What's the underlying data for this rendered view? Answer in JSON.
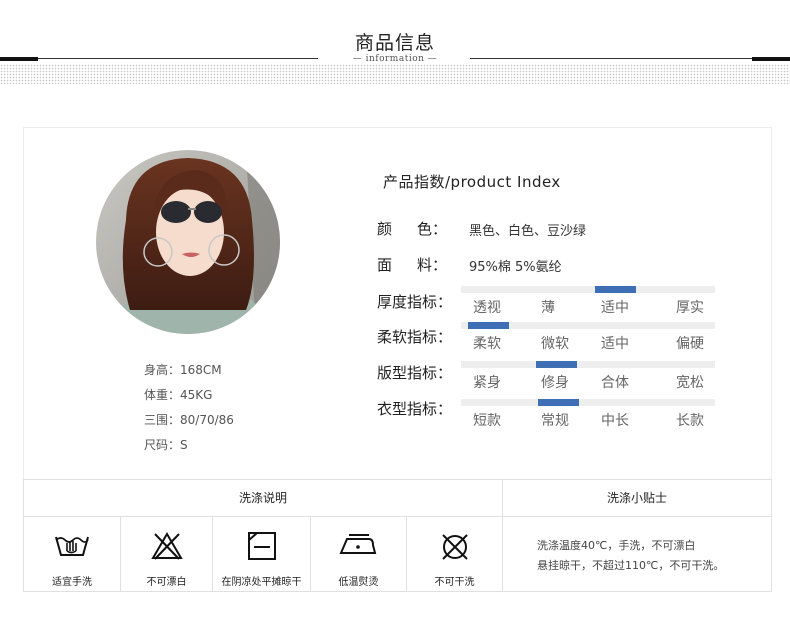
{
  "header": {
    "title": "商品信息",
    "subtitle": "— information —"
  },
  "model": {
    "height": "身高：168CM",
    "weight": "体重：45KG",
    "measurements": "三围：80/70/86",
    "size": "尺码：S"
  },
  "product_index": {
    "title": "产品指数/product Index",
    "color_label": [
      "颜",
      "色："
    ],
    "color_value": "黑色、白色、豆沙绿",
    "material_label": [
      "面",
      "料："
    ],
    "material_value": "95%棉 5%氨纶",
    "indicators": [
      {
        "label": "厚度指标：",
        "options": [
          "透视",
          "薄",
          "适中",
          "厚实"
        ],
        "selected": "适中"
      },
      {
        "label": "柔软指标：",
        "options": [
          "柔软",
          "微软",
          "适中",
          "偏硬"
        ],
        "selected": "柔软"
      },
      {
        "label": "版型指标：",
        "options": [
          "紧身",
          "修身",
          "合体",
          "宽松"
        ],
        "selected": "修身"
      },
      {
        "label": "衣型指标：",
        "options": [
          "短款",
          "常规",
          "中长",
          "长款"
        ],
        "selected": "常规"
      }
    ],
    "accent_color": "#3e6eb4"
  },
  "wash": {
    "left_header": "洗涤说明",
    "right_header": "洗涤小贴士",
    "icons": [
      {
        "icon": "hand-wash-icon",
        "caption": "适宜手洗"
      },
      {
        "icon": "no-bleach-icon",
        "caption": "不可漂白"
      },
      {
        "icon": "dry-flat-shade-icon",
        "caption": "在阴凉处平摊晾干"
      },
      {
        "icon": "iron-low-icon",
        "caption": "低温熨烫"
      },
      {
        "icon": "no-dry-clean-icon",
        "caption": "不可干洗"
      }
    ],
    "tips": [
      "洗涤温度40℃，手洗，不可漂白",
      "悬挂晾干，不超过110℃，不可干洗。"
    ]
  }
}
